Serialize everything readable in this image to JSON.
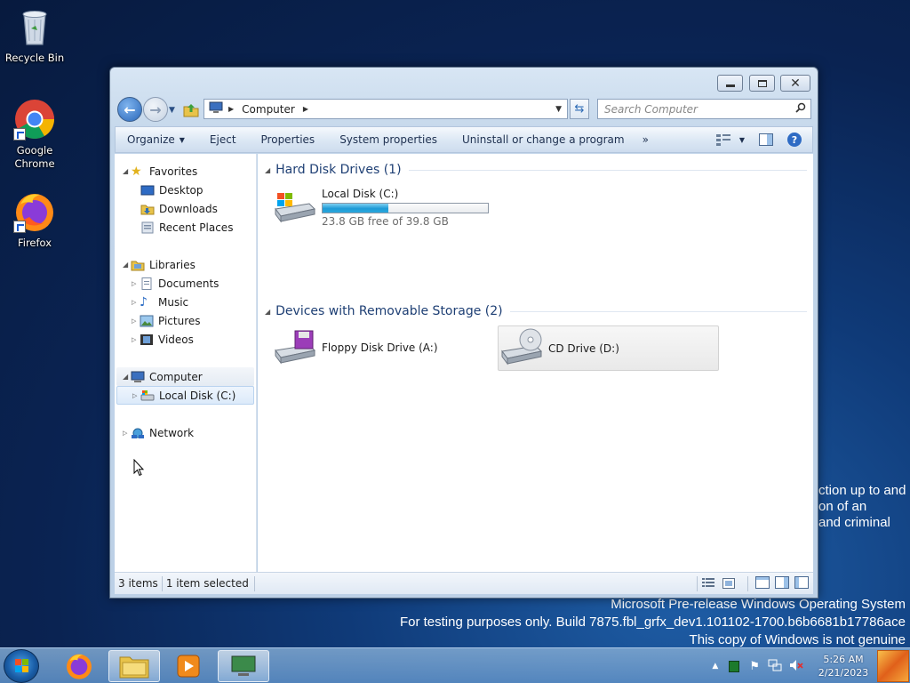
{
  "desktop": {
    "icons": [
      {
        "label": "Recycle Bin"
      },
      {
        "label": "Google Chrome"
      },
      {
        "label": "Firefox"
      }
    ]
  },
  "watermark": {
    "line1": "Microsoft Pre-release Windows Operating System",
    "line2": "For testing purposes only. Build 7875.fbl_grfx_dev1.101102-1700.b6b6681b17786ace",
    "line3": "This copy of Windows is not genuine",
    "eval1": "ction up to and",
    "eval2": "on of an",
    "eval3": "and criminal"
  },
  "window": {
    "address": {
      "location": "Computer"
    },
    "search": {
      "placeholder": "Search Computer"
    },
    "toolbar": {
      "organize": "Organize",
      "eject": "Eject",
      "properties": "Properties",
      "system_properties": "System properties",
      "uninstall": "Uninstall or change a program",
      "more": "»"
    },
    "nav": {
      "favorites": "Favorites",
      "desktop": "Desktop",
      "downloads": "Downloads",
      "recent": "Recent Places",
      "libraries": "Libraries",
      "documents": "Documents",
      "music": "Music",
      "pictures": "Pictures",
      "videos": "Videos",
      "computer": "Computer",
      "local_disk": "Local Disk (C:)",
      "network": "Network"
    },
    "content": {
      "hdd_group": "Hard Disk Drives (1)",
      "removable_group": "Devices with Removable Storage (2)",
      "local_disk": {
        "name": "Local Disk (C:)",
        "free": "23.8 GB free of 39.8 GB",
        "used_fraction": 0.4
      },
      "floppy": "Floppy Disk Drive (A:)",
      "cd": "CD Drive (D:)"
    },
    "status": {
      "items": "3 items",
      "selected": "1 item selected"
    }
  },
  "taskbar": {
    "time": "5:26 AM",
    "date": "2/21/2023"
  },
  "colors": {
    "accent": "#1e3f74",
    "progress": "#1e9ad6"
  }
}
